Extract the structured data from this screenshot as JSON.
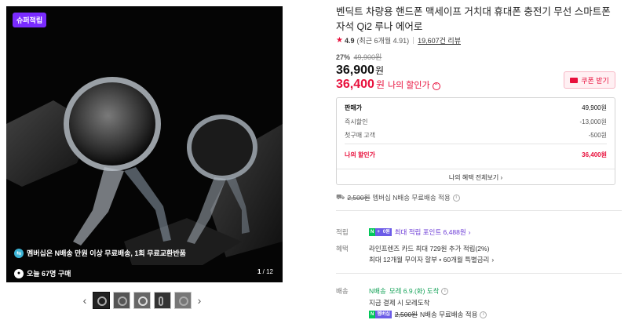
{
  "gallery": {
    "promo_badge": "슈퍼적립",
    "overlay_line1": "멤버십은 N배송 만원 이상 무료배송, 1회 무료교환반품",
    "overlay_line2": "오늘 67명 구매",
    "page_current": "1",
    "page_total": "/ 12",
    "prev_arrow": "‹",
    "next_arrow": "›",
    "thumb_count": 5
  },
  "product": {
    "title": "벤딕트 차량용 핸드폰 맥세이프 거치대 휴대폰 충전기 무선 스마트폰 자석 Qi2 루나 에어로",
    "rating": "4.9",
    "rating_recent": "(최근 6개월 4.91",
    "review_count": "19,607건 리뷰",
    "discount_pct": "27%",
    "original_price": "49,900원",
    "price": "36,900",
    "price_unit": "원",
    "my_price": "36,400",
    "my_price_unit": "원",
    "my_price_label": "나의 할인가",
    "coupon_label": "쿠폰 받기"
  },
  "breakdown": {
    "rows": [
      {
        "label": "판매가",
        "value": "49,900원"
      },
      {
        "label": "즉시할인",
        "value": "-13,000원"
      },
      {
        "label": "첫구매 고객",
        "value": "-500원"
      }
    ],
    "my_price_label": "나의 할인가",
    "my_price_value": "36,400원",
    "more_label": "나의 혜택 전체보기 ›"
  },
  "shipping_top": {
    "orig_fee": "2,500원",
    "text": "멤버십 N배송 무료배송 적용"
  },
  "benefits": {
    "points_label": "적립",
    "points_text": "최대 적립 포인트 6,488원",
    "points_chevron": "›",
    "badge_n": "N",
    "badge_plus": "+",
    "badge_pts": "0원",
    "card_label": "혜택",
    "card_line1": "라인프렌즈 카드 최대 729원 추가 적립(2%)",
    "card_line2": "최대 12개월 무이자 할부 • 60개월 특별금리",
    "card_chevron": "›"
  },
  "delivery": {
    "label": "배송",
    "badge": "N배송",
    "eta": "모레 6.9.(화) 도착",
    "note": "지금 결제 시 모레도착",
    "orig_fee": "2,500원",
    "fee_text": "N배송 무료배송 적용"
  },
  "colors": {
    "accent_red": "#e8103c",
    "naver_green": "#03c75a",
    "membership_purple": "#6c5ce7"
  }
}
